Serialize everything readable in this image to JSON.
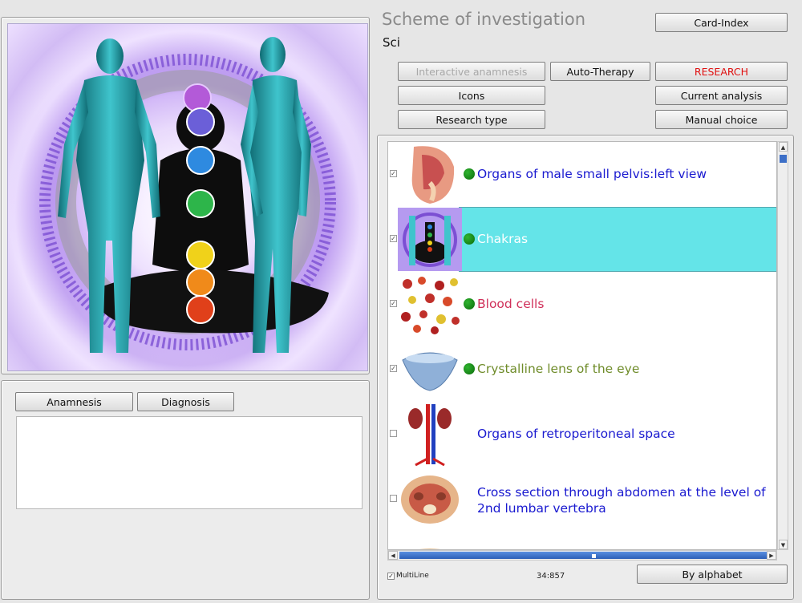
{
  "header": {
    "title": "Scheme of investigation",
    "subtitle": "Sci"
  },
  "toolbar": {
    "card_index": "Card-Index",
    "interactive_anamnesis": "Interactive anamnesis",
    "auto_therapy": "Auto-Therapy",
    "research": "RESEARCH",
    "icons": "Icons",
    "current_analysis": "Current analysis",
    "research_type": "Research type",
    "manual_choice": "Manual choice"
  },
  "notes": {
    "tabs": [
      "Anamnesis",
      "Diagnosis"
    ]
  },
  "list": {
    "items": [
      {
        "label": "Organs of male small pelvis:left view",
        "checked": true,
        "dot": true,
        "color": "#1a1ad0"
      },
      {
        "label": "Chakras",
        "checked": true,
        "dot": true,
        "selected": true,
        "color": "#ffffff"
      },
      {
        "label": "Blood cells",
        "checked": true,
        "dot": true,
        "color": "#d0305a"
      },
      {
        "label": "Crystalline lens of the eye",
        "checked": true,
        "dot": true,
        "color": "#6f8c2a"
      },
      {
        "label": "Organs of retroperitoneal space",
        "checked": false,
        "dot": false,
        "color": "#1a1ad0"
      },
      {
        "label": "Cross section through abdomen at the level of 2nd lumbar vertebra",
        "checked": false,
        "dot": false,
        "color": "#1a1ad0"
      }
    ],
    "multiline_label": "MultiLine",
    "multiline_checked": true,
    "counter": "34:857",
    "sort_button": "By alphabet"
  },
  "colors": {
    "accent_selection": "#64e4e8",
    "research_text": "#e01010",
    "status_dot": "#1a8a1a"
  },
  "icons": {
    "check": "check-icon",
    "status": "green-dot-icon"
  }
}
